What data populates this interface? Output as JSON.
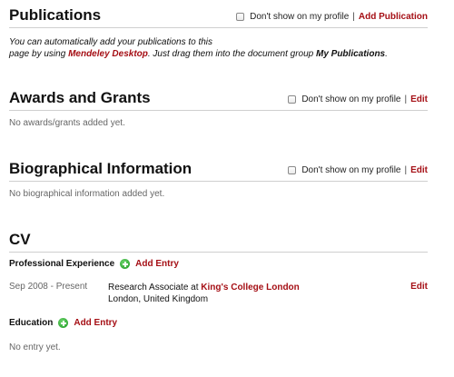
{
  "publications": {
    "title": "Publications",
    "dont_show": "Don't show on my profile",
    "separator": "|",
    "action": "Add Publication",
    "intro": {
      "text1": "You can automatically add your publications to this",
      "text2": "page by using ",
      "link": "Mendeley Desktop",
      "text3": ". Just drag them into the document group ",
      "group": "My Publications",
      "text4": "."
    }
  },
  "awards": {
    "title": "Awards and Grants",
    "dont_show": "Don't show on my profile",
    "separator": "|",
    "action": "Edit",
    "empty_text": "No awards/grants added yet."
  },
  "bio": {
    "title": "Biographical Information",
    "dont_show": "Don't show on my profile",
    "separator": "|",
    "action": "Edit",
    "empty_text": "No biographical information added yet."
  },
  "cv": {
    "title": "CV",
    "experience": {
      "heading": "Professional Experience",
      "add_label": "Add Entry",
      "entries": [
        {
          "dates": "Sep 2008 - Present",
          "role_prefix": "Research Associate at ",
          "organization": "King's College London",
          "location": "London, United Kingdom",
          "edit_label": "Edit"
        }
      ]
    },
    "education": {
      "heading": "Education",
      "add_label": "Add Entry",
      "empty_text": "No entry yet."
    }
  },
  "colors": {
    "link_red": "#a50f15",
    "add_green": "#1f9a24",
    "rule_gray": "#cfcfcf",
    "muted_text": "#666666"
  }
}
